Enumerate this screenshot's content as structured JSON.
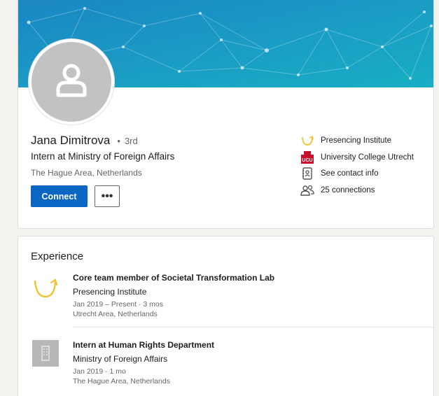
{
  "colors": {
    "accent": "#0a66c2",
    "banner_from": "#1f8fc7",
    "banner_to": "#16b1c3",
    "logo_gold": "#f2c230",
    "ucu_red": "#c8102e"
  },
  "profile": {
    "name": "Jana Dimitrova",
    "degree_separator": "•",
    "degree": "3rd",
    "headline": "Intern at Ministry of Foreign Affairs",
    "location": "The Hague Area, Netherlands",
    "connect_label": "Connect",
    "more_label": "•••",
    "avatar_icon": "person-icon"
  },
  "sidebar": {
    "items": [
      {
        "label": "Presencing Institute",
        "icon": "presencing-logo-icon"
      },
      {
        "label": "University College Utrecht",
        "icon": "ucu-logo-icon",
        "logo_text": "UCU"
      },
      {
        "label": "See contact info",
        "icon": "contact-card-icon"
      },
      {
        "label": "25 connections",
        "icon": "people-icon"
      }
    ]
  },
  "experience": {
    "title": "Experience",
    "items": [
      {
        "title": "Core team member of Societal Transformation Lab",
        "company": "Presencing Institute",
        "dates": "Jan 2019 – Present · 3 mos",
        "location": "Utrecht Area, Netherlands",
        "icon": "presencing-logo-icon"
      },
      {
        "title": "Intern at Human Rights Department",
        "company": "Ministry of Foreign Affairs",
        "dates": "Jan 2019 · 1 mo",
        "location": "The Hague Area, Netherlands",
        "icon": "building-icon"
      }
    ]
  }
}
